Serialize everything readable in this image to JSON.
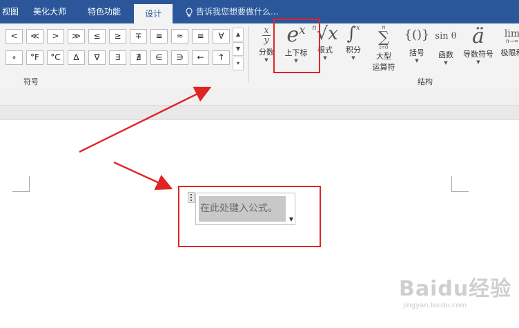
{
  "tabs": [
    {
      "label": "视图",
      "active": false
    },
    {
      "label": "美化大师",
      "active": false
    },
    {
      "label": "特色功能",
      "active": false
    },
    {
      "label": "设计",
      "active": true
    }
  ],
  "tellme": {
    "placeholder": "告诉我您想要做什么..."
  },
  "symbols": {
    "row1": [
      "<",
      "≪",
      ">",
      "≫",
      "≤",
      "≥",
      "∓",
      "≅",
      "≈",
      "≡",
      "∀"
    ],
    "row2": [
      "∘",
      "°F",
      "°C",
      "∆",
      "∇",
      "∃",
      "∄",
      "∈",
      "∋",
      "←",
      "↑"
    ],
    "group_label": "符号"
  },
  "structures": {
    "group_label": "结构",
    "buttons": [
      {
        "glyph": "x/y",
        "label": "分数"
      },
      {
        "glyph": "eˣ",
        "label": "上下标"
      },
      {
        "glyph": "ⁿ√x",
        "label": "根式"
      },
      {
        "glyph": "∫",
        "label": "积分"
      },
      {
        "glyph": "∑",
        "label": "大型",
        "label2": "运算符"
      },
      {
        "glyph": "{()}",
        "label": "括号"
      },
      {
        "glyph": "sin θ",
        "label": "函数"
      },
      {
        "glyph": "ä",
        "label": "导数符号"
      },
      {
        "glyph": "lim",
        "label": "极限和"
      }
    ]
  },
  "equation": {
    "placeholder": "在此处键入公式。"
  },
  "watermark": {
    "brand": "Baidu经验",
    "site": "jingyan.baidu.com"
  },
  "colors": {
    "accent": "#2b579a",
    "highlight": "#e02424"
  }
}
